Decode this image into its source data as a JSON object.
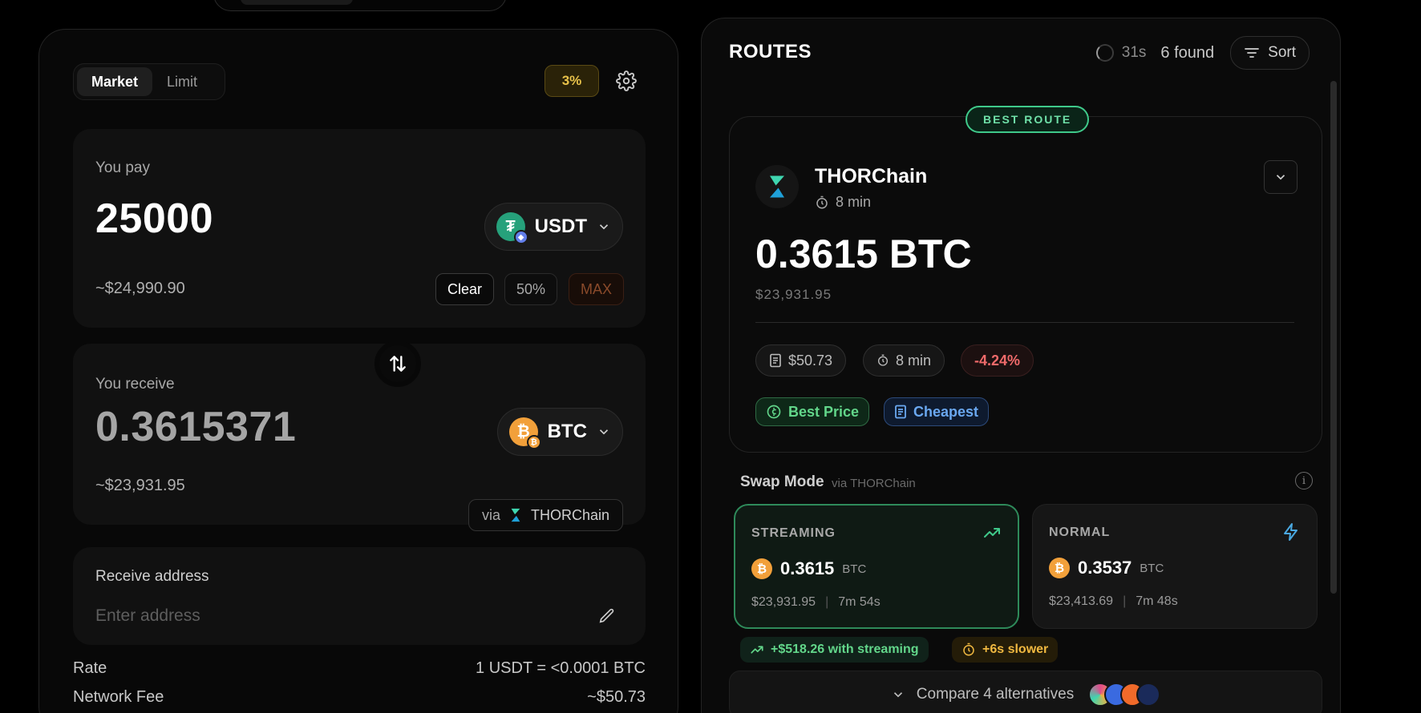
{
  "swap": {
    "mode_tabs": [
      "Market",
      "Limit"
    ],
    "slippage": "3%",
    "pay": {
      "label": "You pay",
      "amount": "25000",
      "token": "USDT",
      "usd": "~$24,990.90",
      "clear": "Clear",
      "half": "50%",
      "max": "MAX"
    },
    "receive": {
      "label": "You receive",
      "amount": "0.3615371",
      "token": "BTC",
      "usd": "~$23,931.95",
      "via_label": "via",
      "via_provider": "THORChain"
    },
    "address": {
      "label": "Receive address",
      "placeholder": "Enter address"
    },
    "details": {
      "rate_label": "Rate",
      "rate_value": "1 USDT = <0.0001 BTC",
      "fee_label": "Network Fee",
      "fee_value": "~$50.73"
    }
  },
  "routes": {
    "title": "ROUTES",
    "timer": "31s",
    "found": "6 found",
    "sort_label": "Sort",
    "best": {
      "badge": "BEST ROUTE",
      "provider": "THORChain",
      "time": "8 min",
      "amount": "0.3615 BTC",
      "usd": "$23,931.95",
      "fee": "$50.73",
      "duration": "8 min",
      "impact": "-4.24%",
      "tag_price": "Best Price",
      "tag_cheap": "Cheapest"
    },
    "swap_mode": {
      "label": "Swap Mode",
      "via": "via THORChain",
      "streaming": {
        "title": "STREAMING",
        "amount": "0.3615",
        "unit": "BTC",
        "usd": "$23,931.95",
        "time": "7m 54s"
      },
      "normal": {
        "title": "NORMAL",
        "amount": "0.3537",
        "unit": "BTC",
        "usd": "$23,413.69",
        "time": "7m 48s"
      },
      "gain_note": "+$518.26 with streaming",
      "slow_note": "+6s slower"
    },
    "compare_label": "Compare 4 alternatives"
  },
  "colors": {
    "accent_green": "#3fc98a",
    "slippage_amber": "#e8c24a",
    "negative_red": "#f06a6a",
    "tag_blue": "#6aa8f0",
    "btc_orange": "#f2a03a",
    "usdt_teal": "#26a17b"
  }
}
